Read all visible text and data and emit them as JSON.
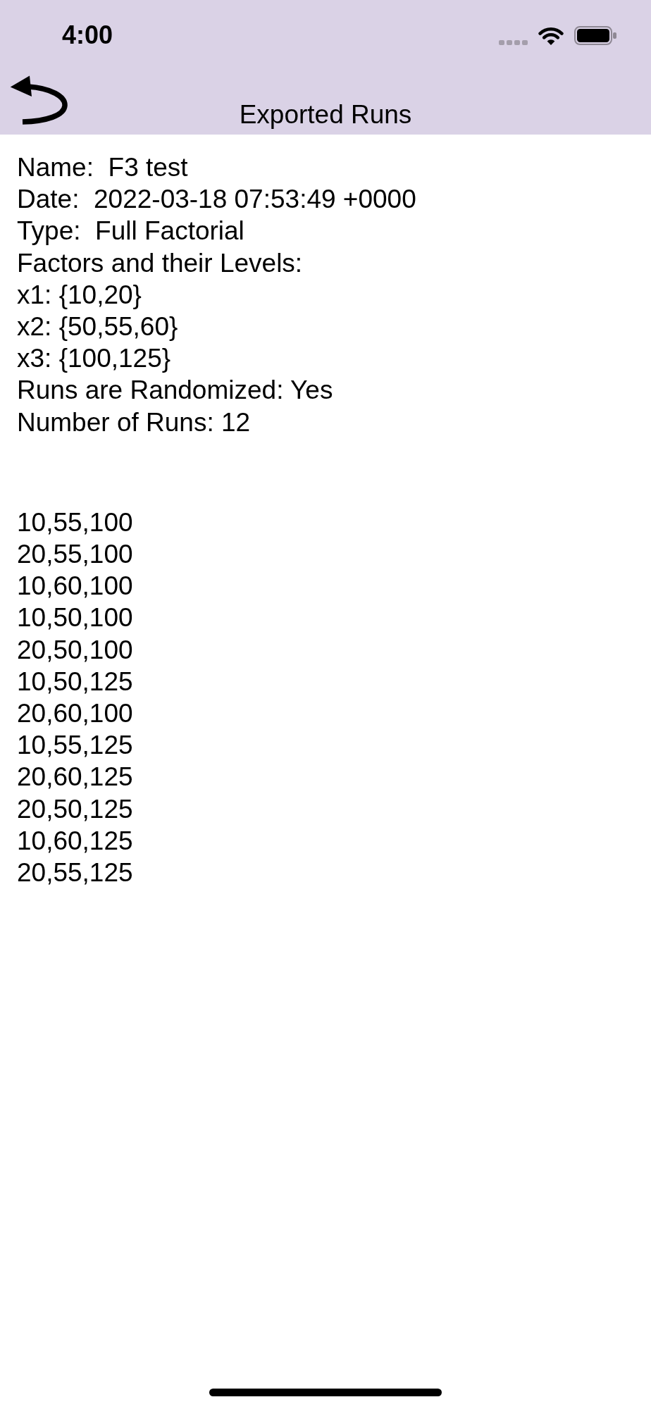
{
  "status_bar": {
    "time": "4:00"
  },
  "nav_bar": {
    "title": "Exported Runs"
  },
  "summary": [
    "Name:  F3 test",
    "Date:  2022-03-18 07:53:49 +0000",
    "Type:  Full Factorial",
    "Factors and their Levels:",
    "x1: {10,20}",
    "x2: {50,55,60}",
    "x3: {100,125}",
    "Runs are Randomized: Yes",
    "Number of Runs: 12"
  ],
  "runs": [
    "10,55,100",
    "20,55,100",
    "10,60,100",
    "10,50,100",
    "20,50,100",
    "10,50,125",
    "20,60,100",
    "10,55,125",
    "20,60,125",
    "20,50,125",
    "10,60,125",
    "20,55,125"
  ]
}
